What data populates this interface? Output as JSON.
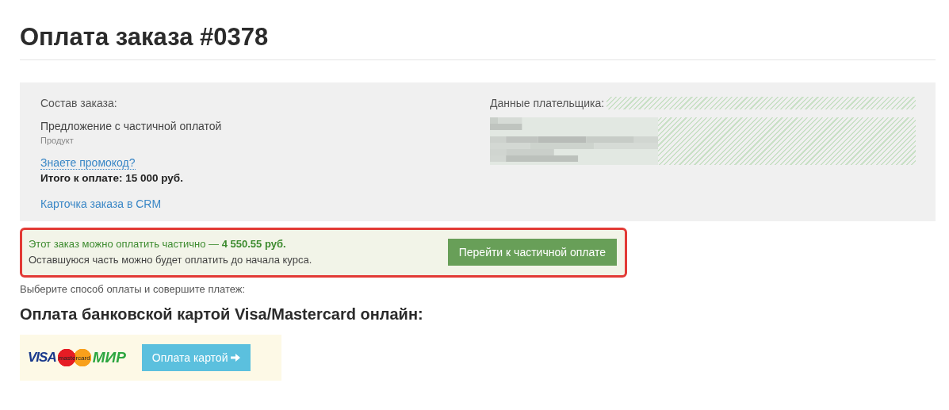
{
  "title": "Оплата заказа #0378",
  "order": {
    "heading": "Состав заказа:",
    "item": "Предложение с частичной оплатой",
    "item_type": "Продукт",
    "promo_link": "Знаете промокод?",
    "total": "Итого к оплате: 15 000 руб.",
    "crm_link": "Карточка заказа в CRM"
  },
  "payer": {
    "heading": "Данные плательщика:"
  },
  "partial": {
    "line1": "Этот заказ можно оплатить частично — **4 550.55 руб.**",
    "line2": "Оставшуюся часть можно будет оплатить до начала курса.",
    "button": "Перейти к частичной оплате"
  },
  "choose_text": "Выберите способ оплаты и совершите платеж:",
  "method": {
    "heading": "Оплата банковской картой Visa/Mastercard онлайн:",
    "logos": [
      "VISA",
      "mastercard",
      "МИР"
    ],
    "button": "Оплата картой"
  }
}
